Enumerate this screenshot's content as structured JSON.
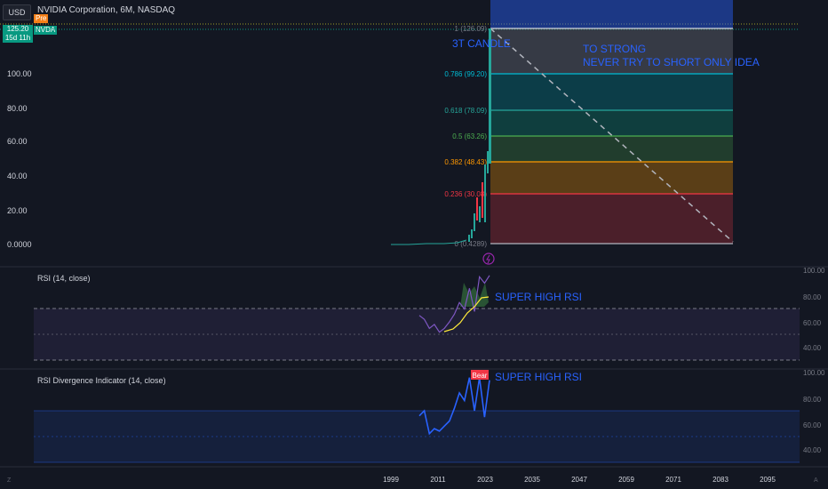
{
  "header": {
    "currency_button": "USD",
    "symbol_title": "NVIDIA Corporation, 6M, NASDAQ",
    "session_badge": "Pre",
    "last_price": "125.20",
    "countdown": "15d 11h",
    "ticker_badge": "NVDA"
  },
  "colors": {
    "background": "#131722",
    "up_candle": "#26a69a",
    "annotation_blue": "#2962ff",
    "fib_red": "#f23645",
    "fib_orange": "#ff9800",
    "fib_green": "#4caf50",
    "fib_teal": "#089981",
    "fib_cyan": "#00bcd4",
    "rsi_purple": "#7e57c2",
    "rsi_signal_yellow": "#ffeb3b",
    "bear_label": "#f23645"
  },
  "price_axis": {
    "labels": [
      "100.00",
      "80.00",
      "60.00",
      "40.00",
      "20.00",
      "0.0000"
    ]
  },
  "time_axis": {
    "labels": [
      "1999",
      "2011",
      "2023",
      "2035",
      "2047",
      "2059",
      "2071",
      "2083",
      "2095"
    ]
  },
  "fibonacci": {
    "levels": [
      {
        "label": "1 (126.09)",
        "ratio": 1,
        "price": 126.09
      },
      {
        "label": "0.786 (99.20)",
        "ratio": 0.786,
        "price": 99.2
      },
      {
        "label": "0.618 (78.09)",
        "ratio": 0.618,
        "price": 78.09
      },
      {
        "label": "0.5 (63.26)",
        "ratio": 0.5,
        "price": 63.26
      },
      {
        "label": "0.382 (48.43)",
        "ratio": 0.382,
        "price": 48.43
      },
      {
        "label": "0.236 (30.08)",
        "ratio": 0.236,
        "price": 30.08
      },
      {
        "label": "0 (0.4289)",
        "ratio": 0,
        "price": 0.4289
      }
    ]
  },
  "annotations": {
    "candle_note": "3T CANDLE",
    "strong_line1": "TO STRONG",
    "strong_line2": "NEVER TRY TO SHORT ONLY IDEA",
    "rsi_note": "SUPER HIGH RSI",
    "divergence_note": "SUPER HIGH RSI",
    "bear_label": "Bear",
    "event_icon": "lightning-icon"
  },
  "rsi_pane": {
    "title": "RSI (14, close)",
    "axis_labels": [
      "100.00",
      "80.00",
      "60.00",
      "40.00"
    ]
  },
  "divergence_pane": {
    "title": "RSI Divergence Indicator (14, close)",
    "axis_labels": [
      "100.00",
      "80.00",
      "60.00",
      "40.00"
    ]
  },
  "chart_data": {
    "type": "line",
    "title": "NVIDIA Corporation, 6M, NASDAQ",
    "y_range": [
      0,
      130
    ],
    "candles_approx": {
      "x": [
        "2016",
        "2017",
        "2018",
        "2019",
        "2020",
        "2021",
        "2022",
        "2023",
        "2024"
      ],
      "close": [
        1,
        5,
        4,
        6,
        13,
        30,
        15,
        49,
        125
      ]
    },
    "rsi_series": {
      "name": "RSI (14, close)",
      "values": [
        65,
        62,
        55,
        58,
        52,
        55,
        60,
        66,
        75,
        70,
        86,
        68,
        95,
        90,
        96
      ]
    },
    "divergence_series": {
      "name": "RSI Divergence Indicator (14, close)",
      "values": [
        66,
        70,
        52,
        56,
        54,
        58,
        62,
        72,
        84,
        78,
        96,
        70,
        96,
        65,
        94
      ]
    }
  }
}
